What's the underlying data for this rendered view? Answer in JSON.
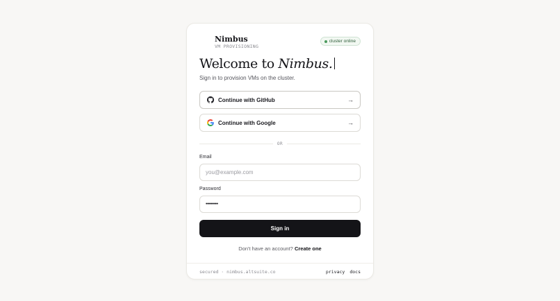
{
  "brand": {
    "name": "Nimbus",
    "subtitle": "VM PROVISIONING",
    "status": "cluster online"
  },
  "heading": {
    "prefix": "Welcome to ",
    "emphasis": "Nimbus."
  },
  "subtitle": "Sign in to provision VMs on the cluster.",
  "oauth": {
    "github_label": "Continue with GitHub",
    "google_label": "Continue with Google",
    "arrow": "→"
  },
  "divider": "OR",
  "form": {
    "email_label": "Email",
    "email_placeholder": "you@example.com",
    "email_value": "",
    "password_label": "Password",
    "password_value": "password1",
    "submit_label": "Sign in"
  },
  "signup": {
    "prompt": "Don't have an account? ",
    "link": "Create one"
  },
  "footer": {
    "meta": "secured · nimbus.altsuite.co",
    "privacy": "privacy",
    "docs": "docs"
  },
  "colors": {
    "primary": "#141418",
    "status_green": "#4a9a5c",
    "background": "#f8f7f5"
  }
}
